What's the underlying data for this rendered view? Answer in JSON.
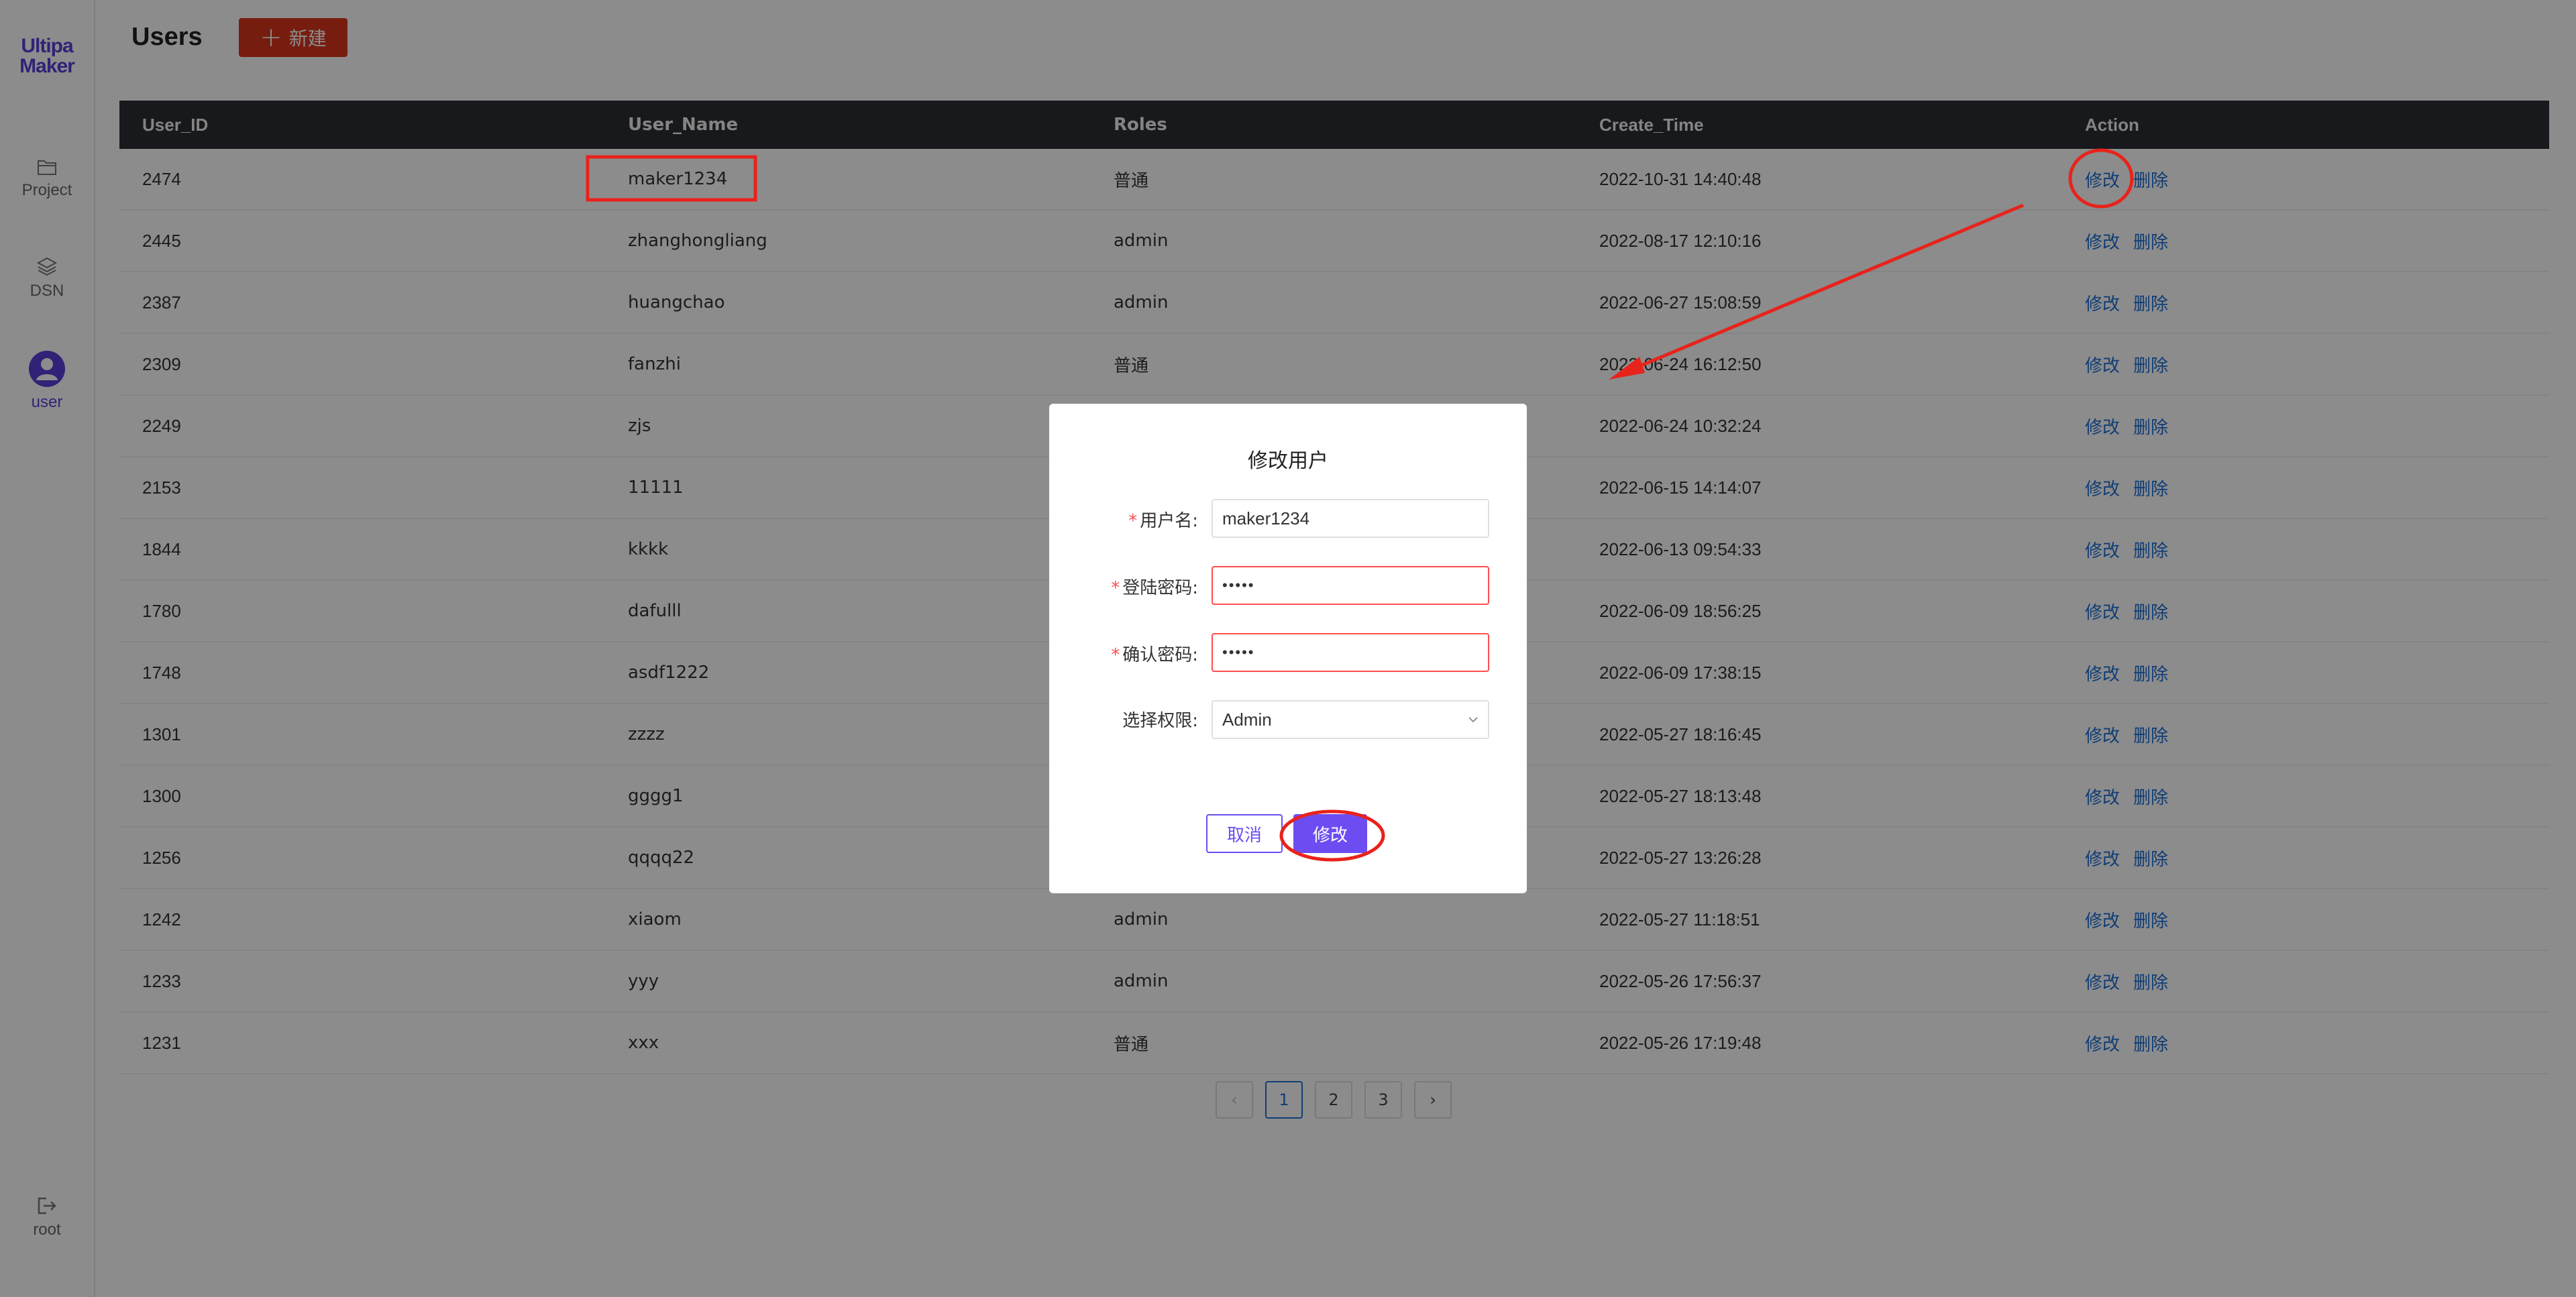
{
  "sidebar": {
    "logo_line1": "Ultipa",
    "logo_line2": "Maker",
    "items": [
      {
        "label": "Project",
        "icon": "folder-icon"
      },
      {
        "label": "DSN",
        "icon": "layers-icon"
      },
      {
        "label": "user",
        "icon": "user-avatar-icon"
      }
    ],
    "bottom": {
      "label": "root",
      "icon": "logout-icon"
    }
  },
  "header": {
    "title": "Users",
    "new_button_label": "新建"
  },
  "table": {
    "columns": [
      "User_ID",
      "User_Name",
      "Roles",
      "Create_Time",
      "Action"
    ],
    "actions": [
      "修改",
      "删除"
    ],
    "rows": [
      {
        "id": "2474",
        "name": "maker1234",
        "role": "普通",
        "time": "2022-10-31 14:40:48"
      },
      {
        "id": "2445",
        "name": "zhanghongliang",
        "role": "admin",
        "time": "2022-08-17 12:10:16"
      },
      {
        "id": "2387",
        "name": "huangchao",
        "role": "admin",
        "time": "2022-06-27 15:08:59"
      },
      {
        "id": "2309",
        "name": "fanzhi",
        "role": "普通",
        "time": "2022-06-24 16:12:50"
      },
      {
        "id": "2249",
        "name": "zjs",
        "role": "",
        "time": "2022-06-24 10:32:24"
      },
      {
        "id": "2153",
        "name": "11111",
        "role": "",
        "time": "2022-06-15 14:14:07"
      },
      {
        "id": "1844",
        "name": "kkkk",
        "role": "",
        "time": "2022-06-13 09:54:33"
      },
      {
        "id": "1780",
        "name": "dafulll",
        "role": "",
        "time": "2022-06-09 18:56:25"
      },
      {
        "id": "1748",
        "name": "asdf1222",
        "role": "",
        "time": "2022-06-09 17:38:15"
      },
      {
        "id": "1301",
        "name": "zzzz",
        "role": "",
        "time": "2022-05-27 18:16:45"
      },
      {
        "id": "1300",
        "name": "gggg1",
        "role": "",
        "time": "2022-05-27 18:13:48"
      },
      {
        "id": "1256",
        "name": "qqqq22",
        "role": "",
        "time": "2022-05-27 13:26:28"
      },
      {
        "id": "1242",
        "name": "xiaom",
        "role": "admin",
        "time": "2022-05-27 11:18:51"
      },
      {
        "id": "1233",
        "name": "yyy",
        "role": "admin",
        "time": "2022-05-26 17:56:37"
      },
      {
        "id": "1231",
        "name": "xxx",
        "role": "普通",
        "time": "2022-05-26 17:19:48"
      }
    ]
  },
  "pagination": {
    "prev": "‹",
    "pages": [
      "1",
      "2",
      "3"
    ],
    "current": "1",
    "next": "›"
  },
  "modal": {
    "title": "修改用户",
    "username_label": "用户名:",
    "username_value": "maker1234",
    "password_label": "登陆密码:",
    "password_value": "•••••",
    "confirm_label": "确认密码:",
    "confirm_value": "•••••",
    "role_label": "选择权限:",
    "role_value": "Admin",
    "cancel_label": "取消",
    "submit_label": "修改"
  },
  "colors": {
    "accent": "#6d4df2",
    "new_button": "#d9361e",
    "link": "#1c6fd8",
    "error": "#ff4d4f",
    "annotation": "#e8231b"
  }
}
